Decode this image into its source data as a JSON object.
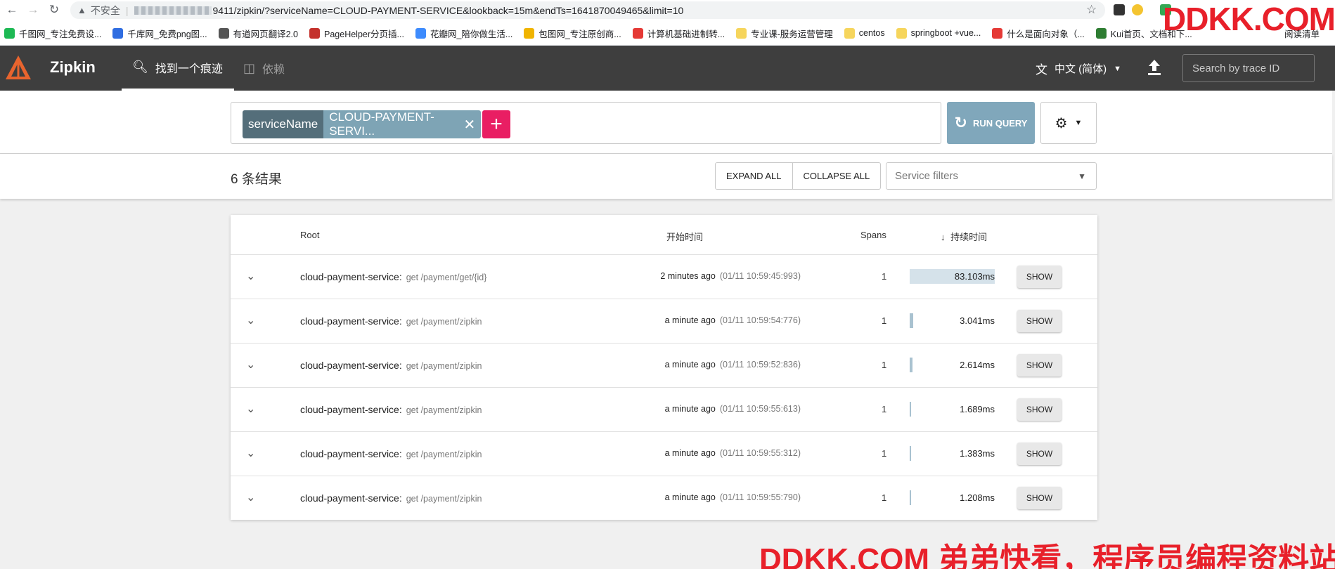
{
  "browser": {
    "security_label": "不安全",
    "url_tail": "9411/zipkin/?serviceName=CLOUD-PAYMENT-SERVICE&lookback=15m&endTs=1641870049465&limit=10",
    "bookmarks": [
      {
        "label": "千图网_专注免费设...",
        "color": "#1db954"
      },
      {
        "label": "千库网_免费png图...",
        "color": "#2f6de1"
      },
      {
        "label": "有道网页翻译2.0",
        "color": "#555555"
      },
      {
        "label": "PageHelper分页插...",
        "color": "#c4302b"
      },
      {
        "label": "花瓣网_陪你做生活...",
        "color": "#3d8bfd"
      },
      {
        "label": "包图网_专注原创商...",
        "color": "#f0b400"
      },
      {
        "label": "计算机基础进制转...",
        "color": "#e53935"
      },
      {
        "label": "专业课-服务运营管理",
        "color": "#f6d55c"
      },
      {
        "label": "centos",
        "color": "#f6d55c"
      },
      {
        "label": "springboot +vue...",
        "color": "#f6d55c"
      },
      {
        "label": "什么是面向对象（...",
        "color": "#e53935"
      },
      {
        "label": "Kui首页、文档和下...",
        "color": "#2e7d32"
      }
    ],
    "reading_list": "阅读清单",
    "watermark_top": "DDKK.COM"
  },
  "header": {
    "brand": "Zipkin",
    "tabs": [
      {
        "label": "找到一个痕迹",
        "active": true
      },
      {
        "label": "依赖",
        "active": false
      }
    ],
    "language": "中文 (简体)",
    "trace_search_placeholder": "Search by trace ID"
  },
  "query": {
    "criteria_key": "serviceName",
    "criteria_value": "CLOUD-PAYMENT-SERVI...",
    "run_label": "RUN QUERY"
  },
  "results": {
    "count_label": "6 条结果",
    "expand_all": "EXPAND ALL",
    "collapse_all": "COLLAPSE ALL",
    "service_filter_placeholder": "Service filters",
    "columns": {
      "root": "Root",
      "start": "开始时间",
      "spans": "Spans",
      "duration": "持续时间"
    },
    "rows": [
      {
        "service": "cloud-payment-service:",
        "path": "get /payment/get/{id}",
        "relative": "2 minutes ago",
        "timestamp": "(01/11 10:59:45:993)",
        "spans": "1",
        "duration": "83.103ms",
        "duration_fraction": 1.0,
        "show": "SHOW"
      },
      {
        "service": "cloud-payment-service:",
        "path": "get /payment/zipkin",
        "relative": "a minute ago",
        "timestamp": "(01/11 10:59:54:776)",
        "spans": "1",
        "duration": "3.041ms",
        "duration_fraction": 0.0366,
        "show": "SHOW"
      },
      {
        "service": "cloud-payment-service:",
        "path": "get /payment/zipkin",
        "relative": "a minute ago",
        "timestamp": "(01/11 10:59:52:836)",
        "spans": "1",
        "duration": "2.614ms",
        "duration_fraction": 0.0315,
        "show": "SHOW"
      },
      {
        "service": "cloud-payment-service:",
        "path": "get /payment/zipkin",
        "relative": "a minute ago",
        "timestamp": "(01/11 10:59:55:613)",
        "spans": "1",
        "duration": "1.689ms",
        "duration_fraction": 0.0203,
        "show": "SHOW"
      },
      {
        "service": "cloud-payment-service:",
        "path": "get /payment/zipkin",
        "relative": "a minute ago",
        "timestamp": "(01/11 10:59:55:312)",
        "spans": "1",
        "duration": "1.383ms",
        "duration_fraction": 0.0166,
        "show": "SHOW"
      },
      {
        "service": "cloud-payment-service:",
        "path": "get /payment/zipkin",
        "relative": "a minute ago",
        "timestamp": "(01/11 10:59:55:790)",
        "spans": "1",
        "duration": "1.208ms",
        "duration_fraction": 0.0145,
        "show": "SHOW"
      }
    ]
  },
  "watermark_bottom": "DDKK.COM 弟弟快看，程序员编程资料站",
  "colors": {
    "header_bg": "#3e3e3e",
    "accent_pink": "#e91e63",
    "run_query": "#80a7bb",
    "chip_key": "#546e7a",
    "chip_value": "#7ea4b5",
    "duration_bar": "#d5e2ea"
  }
}
